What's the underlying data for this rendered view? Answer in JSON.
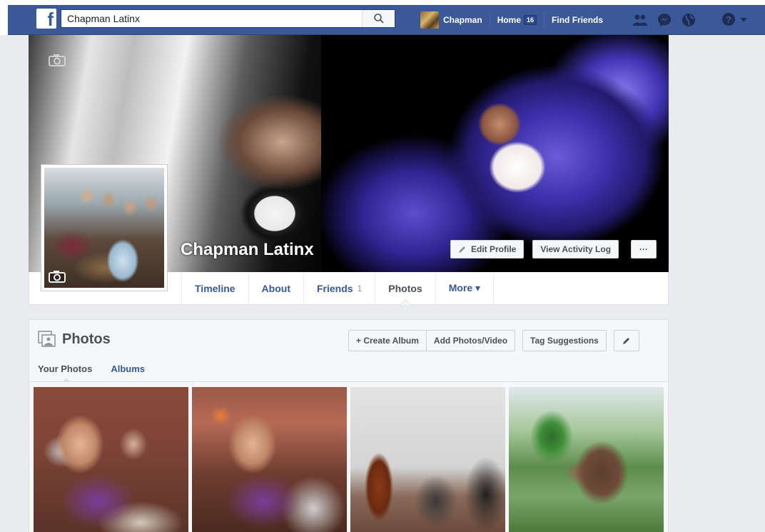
{
  "topbar": {
    "logo": "f",
    "search_value": "Chapman Latinx",
    "user_name": "Chapman",
    "home_label": "Home",
    "home_count": "16",
    "find_friends": "Find Friends"
  },
  "profile": {
    "name": "Chapman Latinx",
    "edit_profile": "Edit Profile",
    "view_activity_log": "View Activity Log",
    "more_dots": "···"
  },
  "tabs": [
    {
      "label": "Timeline"
    },
    {
      "label": "About"
    },
    {
      "label": "Friends",
      "count": "1"
    },
    {
      "label": "Photos"
    },
    {
      "label": "More ▾"
    }
  ],
  "photos": {
    "title": "Photos",
    "create_album": "+ Create Album",
    "add_photos": "Add Photos/Video",
    "tag_suggestions": "Tag Suggestions",
    "subtabs": [
      "Your Photos",
      "Albums"
    ]
  },
  "colors": {
    "brand": "#3b5998",
    "link": "#365899",
    "background": "#e9ebee"
  }
}
